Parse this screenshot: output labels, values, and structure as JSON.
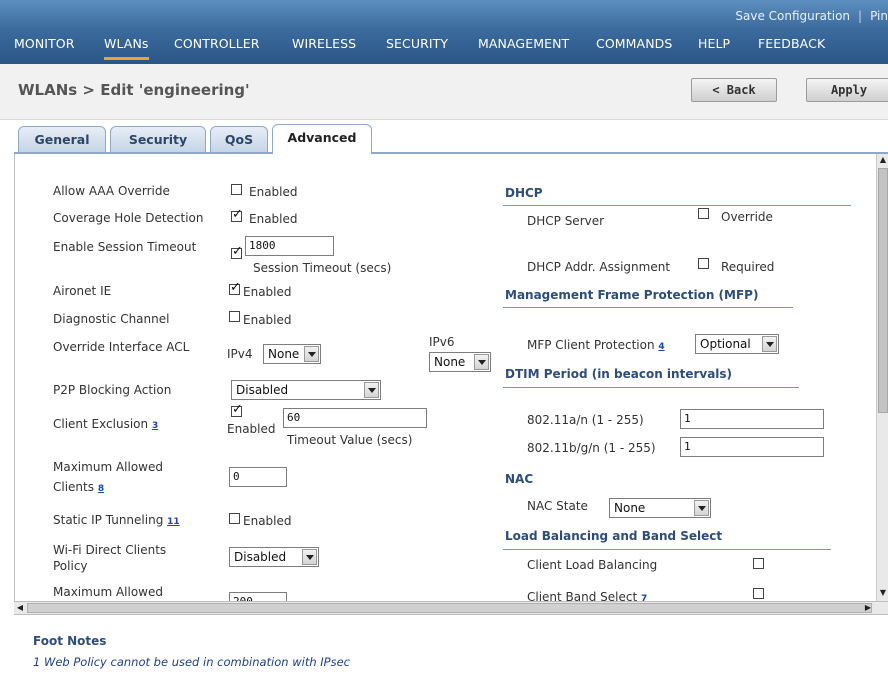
{
  "header": {
    "save_configuration": "Save Configuration",
    "separator": "|",
    "ping": "Pin",
    "menu": [
      "MONITOR",
      "WLANs",
      "CONTROLLER",
      "WIRELESS",
      "SECURITY",
      "MANAGEMENT",
      "COMMANDS",
      "HELP",
      "FEEDBACK"
    ],
    "active_menu": "WLANs"
  },
  "page": {
    "title": "WLANs > Edit  'engineering'",
    "back_button": "< Back",
    "apply_button": "Apply"
  },
  "tabs": [
    {
      "label": "General"
    },
    {
      "label": "Security"
    },
    {
      "label": "QoS"
    },
    {
      "label": "Advanced",
      "active": true
    }
  ],
  "left": {
    "allow_aaa_override": {
      "label": "Allow AAA Override",
      "checked": false,
      "text": "Enabled"
    },
    "coverage_hole_detection": {
      "label": "Coverage Hole Detection",
      "checked": true,
      "text": "Enabled"
    },
    "enable_session_timeout": {
      "label": "Enable Session Timeout",
      "checked": true,
      "value": "1800",
      "units": "Session Timeout (secs)"
    },
    "aironet_ie": {
      "label": "Aironet IE",
      "checked": true,
      "text": "Enabled"
    },
    "diagnostic_channel": {
      "label": "Diagnostic Channel",
      "checked": false,
      "text": "Enabled"
    },
    "override_interface_acl": {
      "label": "Override Interface ACL",
      "ipv4_label": "IPv4",
      "ipv4_value": "None",
      "ipv6_label": "IPv6",
      "ipv6_value": "None"
    },
    "p2p_blocking_action": {
      "label": "P2P Blocking Action",
      "value": "Disabled"
    },
    "client_exclusion": {
      "label": "Client Exclusion",
      "footnote": "3",
      "checked": true,
      "text": "Enabled",
      "value": "60",
      "units": "Timeout Value (secs)"
    },
    "maximum_allowed_clients": {
      "label_line1": "Maximum Allowed",
      "label_line2": "Clients",
      "footnote": "8",
      "value": "0"
    },
    "static_ip_tunneling": {
      "label": "Static IP Tunneling",
      "footnote": "11",
      "checked": false,
      "text": "Enabled"
    },
    "wifi_direct_clients_policy": {
      "label_line1": "Wi-Fi Direct Clients",
      "label_line2": "Policy",
      "value": "Disabled"
    },
    "maximum_allowed_per_ap": {
      "label_line1": "Maximum Allowed",
      "value": "200"
    }
  },
  "right": {
    "dhcp": {
      "heading": "DHCP",
      "server_label": "DHCP Server",
      "server_checked": false,
      "server_text": "Override",
      "addr_label": "DHCP Addr. Assignment",
      "addr_checked": false,
      "addr_text": "Required"
    },
    "mfp": {
      "heading": "Management Frame Protection (MFP)",
      "client_protection_label": "MFP Client Protection",
      "footnote": "4",
      "value": "Optional"
    },
    "dtim": {
      "heading": "DTIM Period (in beacon intervals)",
      "a_label": "802.11a/n (1 - 255)",
      "a_value": "1",
      "b_label": "802.11b/g/n (1 - 255)",
      "b_value": "1"
    },
    "nac": {
      "heading": "NAC",
      "state_label": "NAC State",
      "state_value": "None"
    },
    "load_balancing": {
      "heading": "Load Balancing and Band Select",
      "client_lb_label": "Client Load Balancing",
      "client_lb_checked": false,
      "band_select_label": "Client Band Select",
      "footnote": "7",
      "band_select_checked": false
    }
  },
  "footnotes": {
    "title": "Foot Notes",
    "items": [
      "1 Web Policy cannot be used in combination with IPsec"
    ]
  }
}
